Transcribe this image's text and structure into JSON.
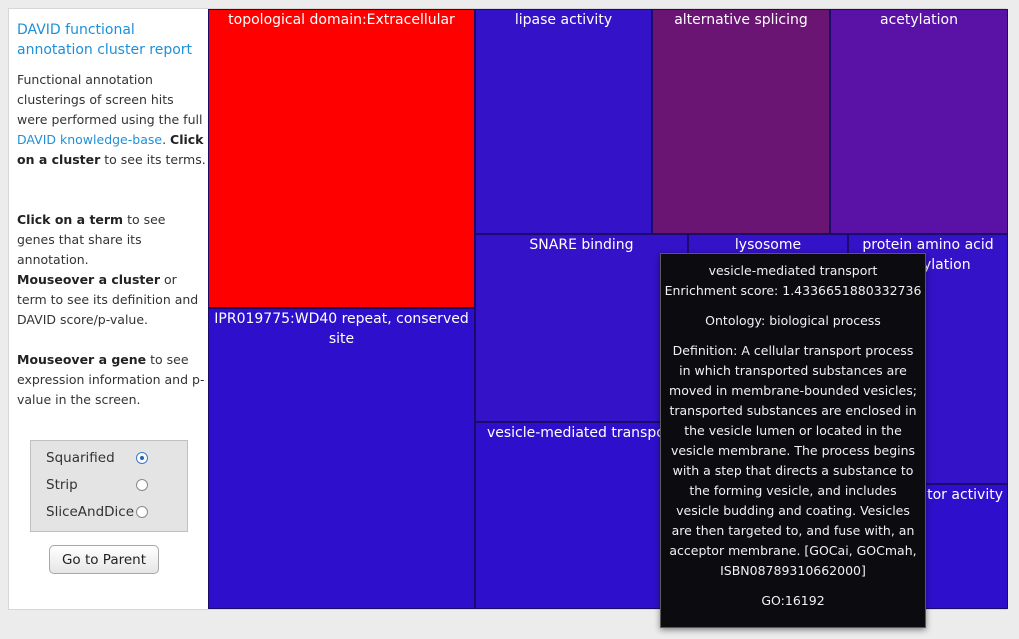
{
  "sidebar": {
    "title": "DAVID functional annotation cluster report",
    "intro_text": "Functional annotation clusterings of screen hits were performed using the full",
    "intro_link": "DAVID knowledge-base",
    "click_cluster_bold": "Click on a cluster",
    "click_cluster_text": " to see its terms.",
    "click_term_bold": "Click on a term",
    "click_term_text": " to see genes that share its annotation.",
    "mouseover_cluster_bold": "Mouseover a cluster",
    "mouseover_cluster_text": " or term to see its definition and DAVID score/p-value.",
    "mouseover_gene_bold": "Mouseover a gene",
    "mouseover_gene_text": " to see expression information and p-value in the screen.",
    "layout_options": [
      "Squarified",
      "Strip",
      "SliceAndDice"
    ],
    "selected_layout": "Squarified",
    "go_parent_label": "Go to Parent"
  },
  "treemap": {
    "cells": [
      {
        "label": "topological domain:Extracellular",
        "color": "#ff0000"
      },
      {
        "label": "IPR019775:WD40 repeat, conserved site",
        "color": "#2e10cc"
      },
      {
        "label": "lipase activity",
        "color": "#3412c8"
      },
      {
        "label": "alternative splicing",
        "color": "#6a1474"
      },
      {
        "label": "acetylation",
        "color": "#5a12a6"
      },
      {
        "label": "SNARE binding",
        "color": "#3412c8"
      },
      {
        "label": "lysosome",
        "color": "#3412c8"
      },
      {
        "label": "protein amino acid dealkylation",
        "color": "#3412c8"
      },
      {
        "label": "vesicle-mediated transport",
        "color": "#2e10cc"
      },
      {
        "label": "",
        "color": "#2e10cc"
      },
      {
        "label": "itor activity",
        "color": "#2e10cc"
      }
    ]
  },
  "tooltip": {
    "term": "vesicle-mediated transport",
    "enrichment": "Enrichment score: 1.4336651880332736",
    "ontology": "Ontology: biological process",
    "definition": "Definition: A cellular transport process in which transported substances are moved in membrane-bounded vesicles; transported substances are enclosed in the vesicle lumen or located in the vesicle membrane. The process begins with a step that directs a substance to the forming vesicle, and includes vesicle budding and coating. Vesicles are then targeted to, and fuse with, an acceptor membrane. [GOCai, GOCmah, ISBN08789310662000]",
    "go_id": "GO:16192"
  }
}
